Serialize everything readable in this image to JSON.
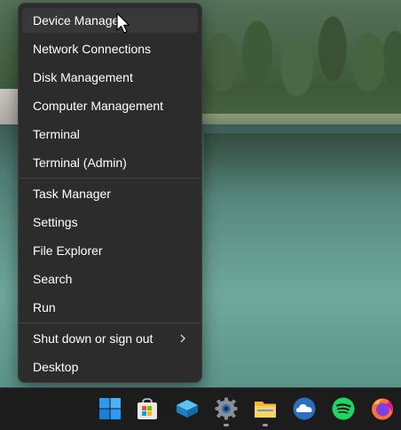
{
  "menu": {
    "groups": [
      [
        {
          "label": "Device Manager",
          "name": "menu-item-device-manager"
        },
        {
          "label": "Network Connections",
          "name": "menu-item-network-connections"
        },
        {
          "label": "Disk Management",
          "name": "menu-item-disk-management"
        },
        {
          "label": "Computer Management",
          "name": "menu-item-computer-management"
        },
        {
          "label": "Terminal",
          "name": "menu-item-terminal"
        },
        {
          "label": "Terminal (Admin)",
          "name": "menu-item-terminal-admin"
        }
      ],
      [
        {
          "label": "Task Manager",
          "name": "menu-item-task-manager"
        },
        {
          "label": "Settings",
          "name": "menu-item-settings"
        },
        {
          "label": "File Explorer",
          "name": "menu-item-file-explorer"
        },
        {
          "label": "Search",
          "name": "menu-item-search"
        },
        {
          "label": "Run",
          "name": "menu-item-run"
        }
      ],
      [
        {
          "label": "Shut down or sign out",
          "name": "menu-item-shut-down",
          "submenu": true
        },
        {
          "label": "Desktop",
          "name": "menu-item-desktop"
        }
      ]
    ],
    "hovered": "Device Manager"
  },
  "taskbar": {
    "icons": [
      {
        "name": "start-windows-icon",
        "running": false
      },
      {
        "name": "microsoft-store-icon",
        "running": false
      },
      {
        "name": "box-app-icon",
        "running": false
      },
      {
        "name": "settings-gear-icon",
        "running": true
      },
      {
        "name": "file-explorer-icon",
        "running": true
      },
      {
        "name": "cloud-app-icon",
        "running": false
      },
      {
        "name": "spotify-icon",
        "running": false
      },
      {
        "name": "firefox-icon",
        "running": false
      }
    ]
  },
  "colors": {
    "menu_bg": "#2c2c2c",
    "menu_hover": "#383838",
    "taskbar_bg": "#1c1c1c",
    "accent_blue": "#1e90e8",
    "spotify_green": "#1ed760"
  }
}
